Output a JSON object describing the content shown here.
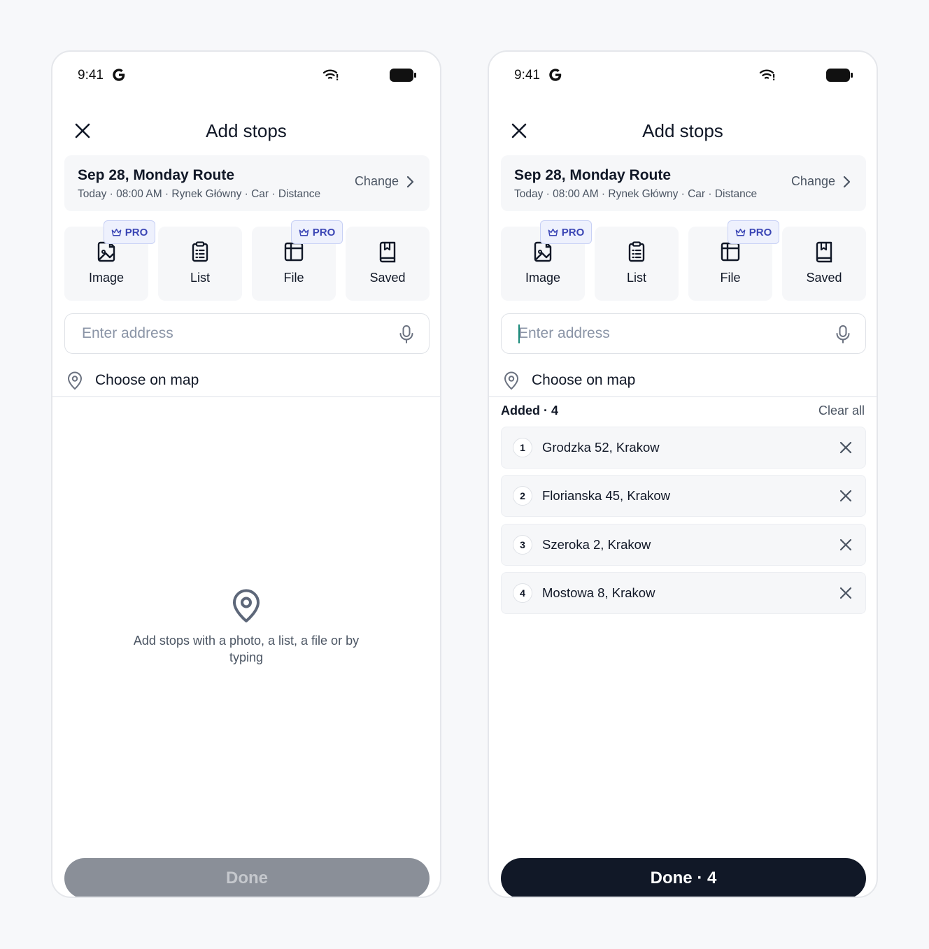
{
  "colors": {
    "background": "#f7f8fa",
    "card": "#f6f7f9",
    "primary_dark": "#111827",
    "text_secondary": "#4b5563",
    "placeholder": "#8a94a6",
    "pro_badge_bg": "#eef1fd",
    "pro_badge_text": "#3b46b5",
    "done_disabled": "#8a8f98",
    "cursor": "#1a8a7a"
  },
  "screens": [
    {
      "status_bar": {
        "time": "9:41",
        "icons": [
          "google-g-icon",
          "wifi-icon",
          "battery-icon"
        ]
      },
      "header": {
        "title": "Add stops",
        "close_icon": "close-icon"
      },
      "route": {
        "title": "Sep 28, Monday Route",
        "subtitle": "Today · 08:00 AM · Rynek Główny · Car · Distance",
        "change_label": "Change"
      },
      "sources": [
        {
          "label": "Image",
          "icon": "image-icon",
          "pro": "PRO"
        },
        {
          "label": "List",
          "icon": "clipboard-list-icon"
        },
        {
          "label": "File",
          "icon": "table-file-icon",
          "pro": "PRO"
        },
        {
          "label": "Saved",
          "icon": "bookmark-book-icon"
        }
      ],
      "address": {
        "placeholder": "Enter address",
        "value": "",
        "focused": false
      },
      "choose_on_map": "Choose on map",
      "empty_state": {
        "text": "Add stops with a photo, a list, a file or by typing"
      },
      "done": {
        "label": "Done",
        "enabled": false
      }
    },
    {
      "status_bar": {
        "time": "9:41",
        "icons": [
          "google-g-icon",
          "wifi-icon",
          "battery-icon"
        ]
      },
      "header": {
        "title": "Add stops",
        "close_icon": "close-icon"
      },
      "route": {
        "title": "Sep 28, Monday Route",
        "subtitle": "Today · 08:00 AM · Rynek Główny · Car · Distance",
        "change_label": "Change"
      },
      "sources": [
        {
          "label": "Image",
          "icon": "image-icon",
          "pro": "PRO"
        },
        {
          "label": "List",
          "icon": "clipboard-list-icon"
        },
        {
          "label": "File",
          "icon": "table-file-icon",
          "pro": "PRO"
        },
        {
          "label": "Saved",
          "icon": "bookmark-book-icon"
        }
      ],
      "address": {
        "placeholder": "Enter address",
        "value": "",
        "focused": true
      },
      "choose_on_map": "Choose on map",
      "added": {
        "label": "Added · 4",
        "clear_all": "Clear all",
        "stops": [
          {
            "number": "1",
            "address": "Grodzka 52, Krakow"
          },
          {
            "number": "2",
            "address": "Florianska 45, Krakow"
          },
          {
            "number": "3",
            "address": "Szeroka 2, Krakow"
          },
          {
            "number": "4",
            "address": "Mostowa 8, Krakow"
          }
        ]
      },
      "done": {
        "label": "Done · 4",
        "enabled": true
      }
    }
  ]
}
